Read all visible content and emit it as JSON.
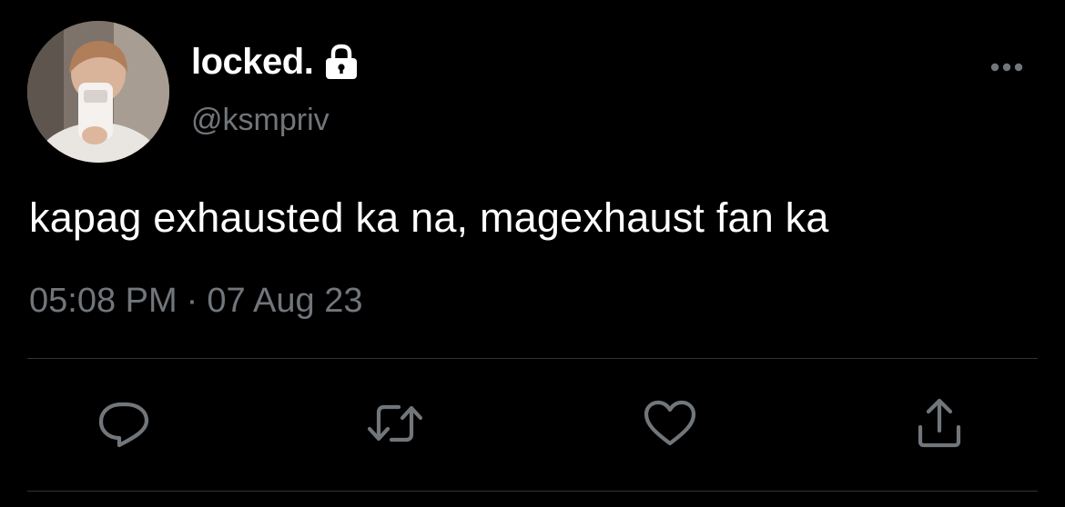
{
  "tweet": {
    "author": {
      "display_name": "locked.",
      "handle": "@ksmpriv",
      "avatar_icon": "profile-photo",
      "protected_icon": "lock-icon"
    },
    "text": "kapag exhausted ka na, magexhaust fan ka",
    "timestamp": {
      "time": "05:08 PM",
      "separator": "·",
      "date": "07 Aug 23"
    },
    "actions": {
      "reply_icon": "reply-icon",
      "retweet_icon": "retweet-icon",
      "like_icon": "heart-icon",
      "share_icon": "share-icon"
    },
    "more_icon": "more-icon"
  },
  "colors": {
    "background": "#000000",
    "primary_text": "#ffffff",
    "secondary_text": "#71767b",
    "divider": "#2f3336"
  }
}
